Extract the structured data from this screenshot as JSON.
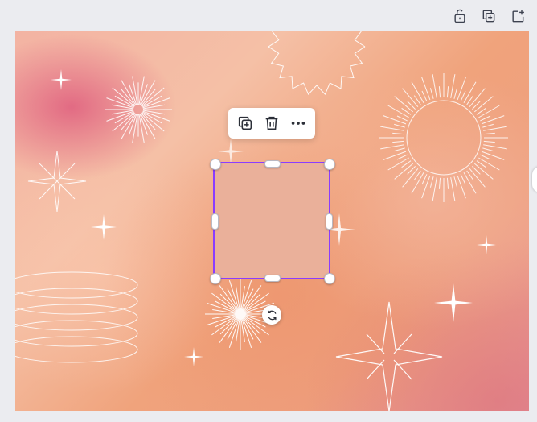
{
  "topbar": {
    "icons": [
      "lock-icon",
      "duplicate-page-icon",
      "add-page-icon"
    ]
  },
  "toolbar": {
    "icons": [
      "duplicate-icon",
      "trash-icon",
      "more-icon"
    ]
  },
  "colors": {
    "selection": "#8b3dff",
    "shape_fill": "#eab09a",
    "app_background": "#ebecf0"
  }
}
